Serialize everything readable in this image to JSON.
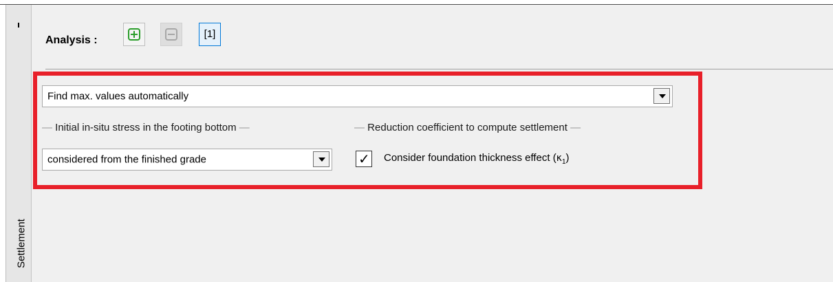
{
  "side_tab": {
    "label": "Settlement"
  },
  "analysis": {
    "label": "Analysis :",
    "add_icon": "plus-square-icon",
    "remove_icon": "minus-square-icon",
    "current_button": "[1]"
  },
  "main_select": {
    "value": "Find max. values automatically"
  },
  "stress_group": {
    "title": "Initial in-situ stress in the footing bottom",
    "select_value": "considered from the finished grade"
  },
  "reduction_group": {
    "title": "Reduction coefficient to compute settlement",
    "checkbox_checked": true,
    "checkbox_label": "Consider foundation thickness effect",
    "symbol": "κ",
    "symbol_sub": "1"
  },
  "colors": {
    "highlight": "#e8202a",
    "add": "#2a9d2a",
    "selected_border": "#0078d7"
  }
}
